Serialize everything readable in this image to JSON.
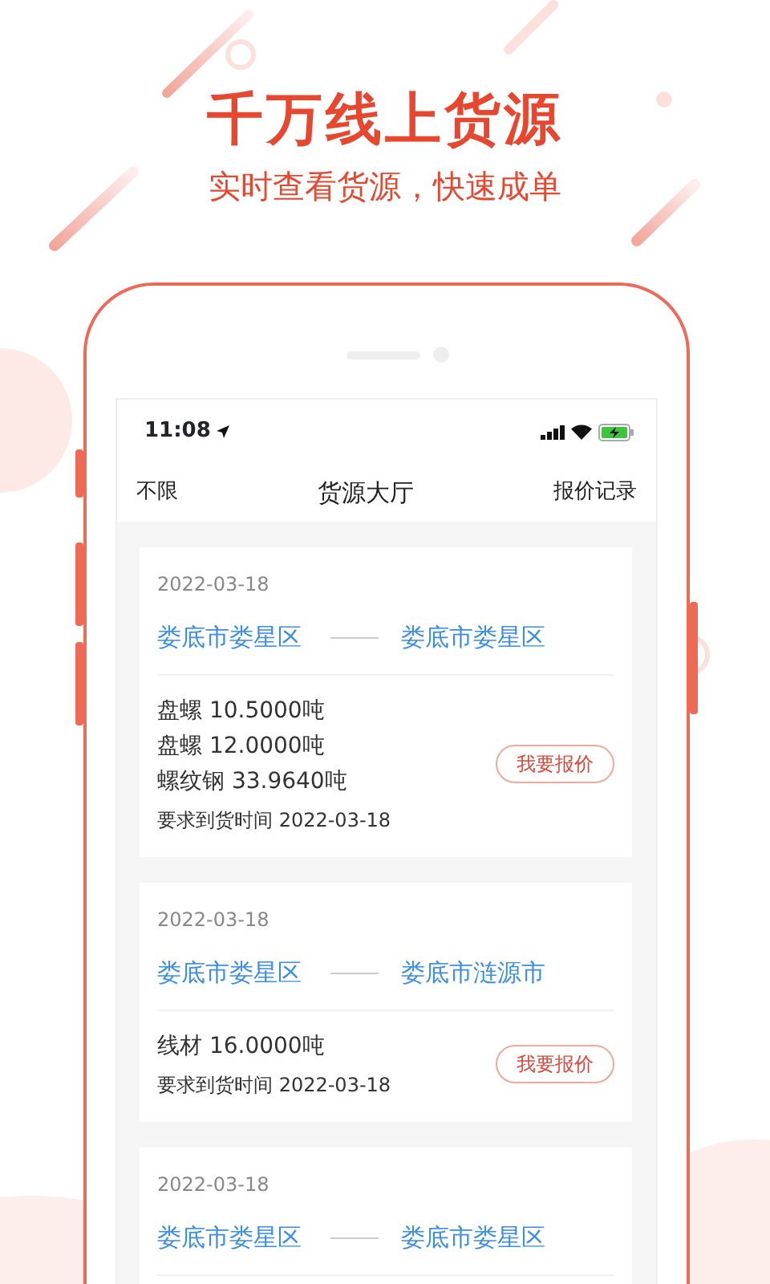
{
  "headline": "千万线上货源",
  "subheadline": "实时查看货源，快速成单",
  "status_bar": {
    "time": "11:08"
  },
  "nav": {
    "left": "不限",
    "title": "货源大厅",
    "right": "报价记录"
  },
  "cards": [
    {
      "date": "2022-03-18",
      "from": "娄底市娄星区",
      "to": "娄底市娄星区",
      "items": [
        "盘螺 10.5000吨",
        "盘螺 12.0000吨",
        "螺纹钢 33.9640吨"
      ],
      "deadline": "要求到货时间 2022-03-18",
      "button": "我要报价"
    },
    {
      "date": "2022-03-18",
      "from": "娄底市娄星区",
      "to": "娄底市涟源市",
      "items": [
        "线材 16.0000吨"
      ],
      "deadline": "要求到货时间 2022-03-18",
      "button": "我要报价"
    },
    {
      "date": "2022-03-18",
      "from": "娄底市娄星区",
      "to": "娄底市娄星区"
    }
  ]
}
